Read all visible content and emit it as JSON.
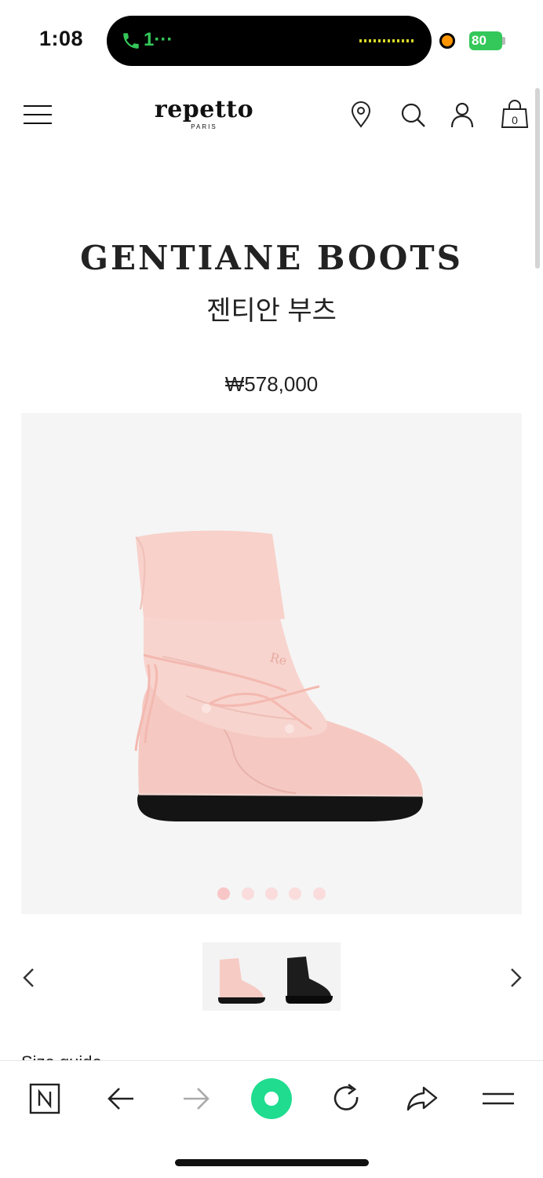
{
  "status_bar": {
    "time": "1:08",
    "call_text": "1···",
    "battery": "80"
  },
  "header": {
    "logo": "repetto",
    "logo_sub": "PARIS",
    "icons": [
      "menu-icon",
      "location-pin-icon",
      "search-icon",
      "account-icon",
      "shopping-bag-icon"
    ],
    "cart_count": "0"
  },
  "product": {
    "title": "GENTIANE BOOTS",
    "subtitle": "젠티안 부츠",
    "price": "₩578,000",
    "image_dots": 5,
    "active_dot": 1,
    "variants": [
      "pink",
      "black"
    ]
  },
  "colors": {
    "boot_pink": "#f7cdc6",
    "dot_pink": "#fbdcdc",
    "image_bg": "#f5f5f5",
    "accent_green": "#1fdc8f"
  },
  "section": {
    "size_guide": "Size guide"
  },
  "toolbar": {
    "icons": [
      "naver-n-icon",
      "back-arrow-icon",
      "forward-arrow-icon",
      "home-dot-icon",
      "refresh-icon",
      "share-icon",
      "menu-icon"
    ]
  }
}
